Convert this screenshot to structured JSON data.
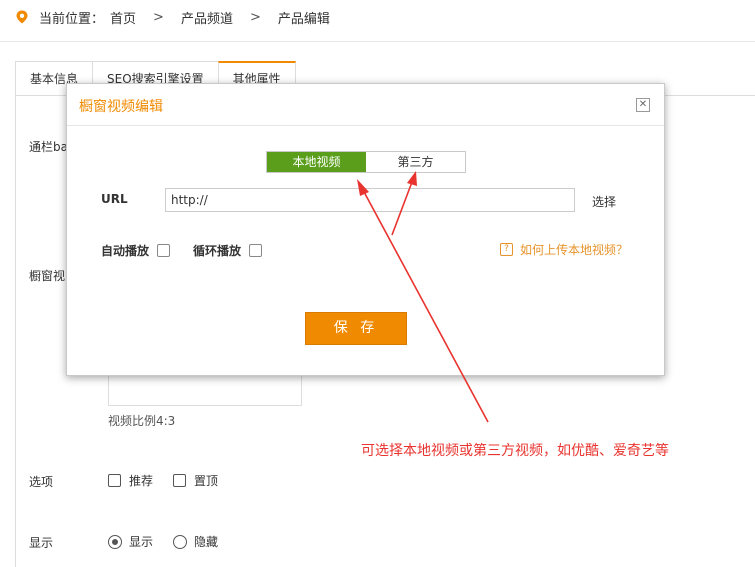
{
  "breadcrumb": {
    "prefix": "当前位置：",
    "items": [
      "首页",
      "产品频道",
      "产品编辑"
    ],
    "separator": ">"
  },
  "tabs": [
    {
      "label": "基本信息",
      "active": false
    },
    {
      "label": "SEO搜索引擎设置",
      "active": false
    },
    {
      "label": "其他属性",
      "active": true
    }
  ],
  "form": {
    "banner_label": "通栏ba",
    "window_video_label": "橱窗视",
    "video_ratio": "视频比例4:3",
    "options": {
      "label": "选项",
      "items": [
        {
          "label": "推荐",
          "checked": false
        },
        {
          "label": "置顶",
          "checked": false
        }
      ]
    },
    "display": {
      "label": "显示",
      "items": [
        {
          "label": "显示",
          "selected": true
        },
        {
          "label": "隐藏",
          "selected": false
        }
      ]
    }
  },
  "modal": {
    "title": "橱窗视频编辑",
    "close_icon": "close-icon",
    "source_switch": [
      {
        "label": "本地视频",
        "active": true
      },
      {
        "label": "第三方",
        "active": false
      }
    ],
    "url_label": "URL",
    "url_value": "http://",
    "choose_label": "选择",
    "autoplay_label": "自动播放",
    "loop_label": "循环播放",
    "help_icon": "question-icon",
    "help_text": "如何上传本地视频？",
    "save_label": "保 存"
  },
  "annotation": {
    "text": "可选择本地视频或第三方视频，如优酷、爱奇艺等"
  },
  "colors": {
    "accent": "#f08a00",
    "switch_active": "#5a9e1c",
    "annotation": "#e8332e"
  }
}
